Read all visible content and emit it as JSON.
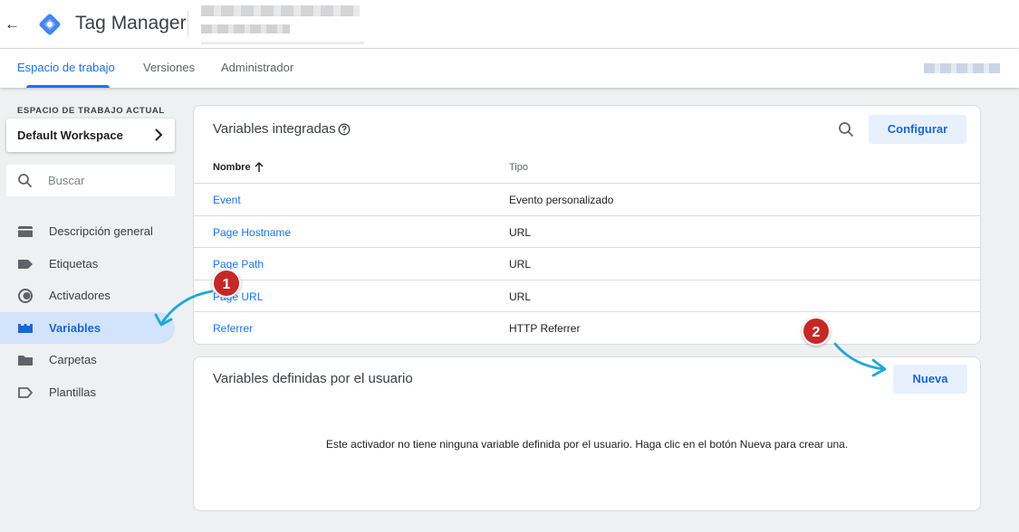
{
  "header": {
    "app_title": "Tag Manager"
  },
  "tabs": [
    {
      "label": "Espacio de trabajo",
      "active": true
    },
    {
      "label": "Versiones",
      "active": false
    },
    {
      "label": "Administrador",
      "active": false
    }
  ],
  "sidebar": {
    "workspace_label": "ESPACIO DE TRABAJO ACTUAL",
    "workspace_name": "Default Workspace",
    "search_placeholder": "Buscar",
    "items": [
      {
        "label": "Descripción general",
        "icon": "overview-icon",
        "active": false
      },
      {
        "label": "Etiquetas",
        "icon": "tag-icon",
        "active": false
      },
      {
        "label": "Activadores",
        "icon": "trigger-icon",
        "active": false
      },
      {
        "label": "Variables",
        "icon": "variables-icon",
        "active": true
      },
      {
        "label": "Carpetas",
        "icon": "folder-icon",
        "active": false
      },
      {
        "label": "Plantillas",
        "icon": "template-icon",
        "active": false
      }
    ]
  },
  "builtin": {
    "title": "Variables integradas",
    "configure_label": "Configurar",
    "col_name": "Nombre",
    "col_type": "Tipo",
    "rows": [
      {
        "name": "Event",
        "type": "Evento personalizado"
      },
      {
        "name": "Page Hostname",
        "type": "URL"
      },
      {
        "name": "Page Path",
        "type": "URL"
      },
      {
        "name": "Page URL",
        "type": "URL"
      },
      {
        "name": "Referrer",
        "type": "HTTP Referrer"
      }
    ]
  },
  "user_defined": {
    "title": "Variables definidas por el usuario",
    "new_label": "Nueva",
    "empty_message": "Este activador no tiene ninguna variable definida por el usuario. Haga clic en el botón Nueva para crear una."
  },
  "annotations": {
    "step1": "1",
    "step2": "2"
  },
  "colors": {
    "accent": "#1a73e8",
    "active_nav_bg": "#d2e3fc",
    "button_bg": "#e8f0fe",
    "callout": "#c62828",
    "annotation_arrow": "#1fa8d6"
  }
}
